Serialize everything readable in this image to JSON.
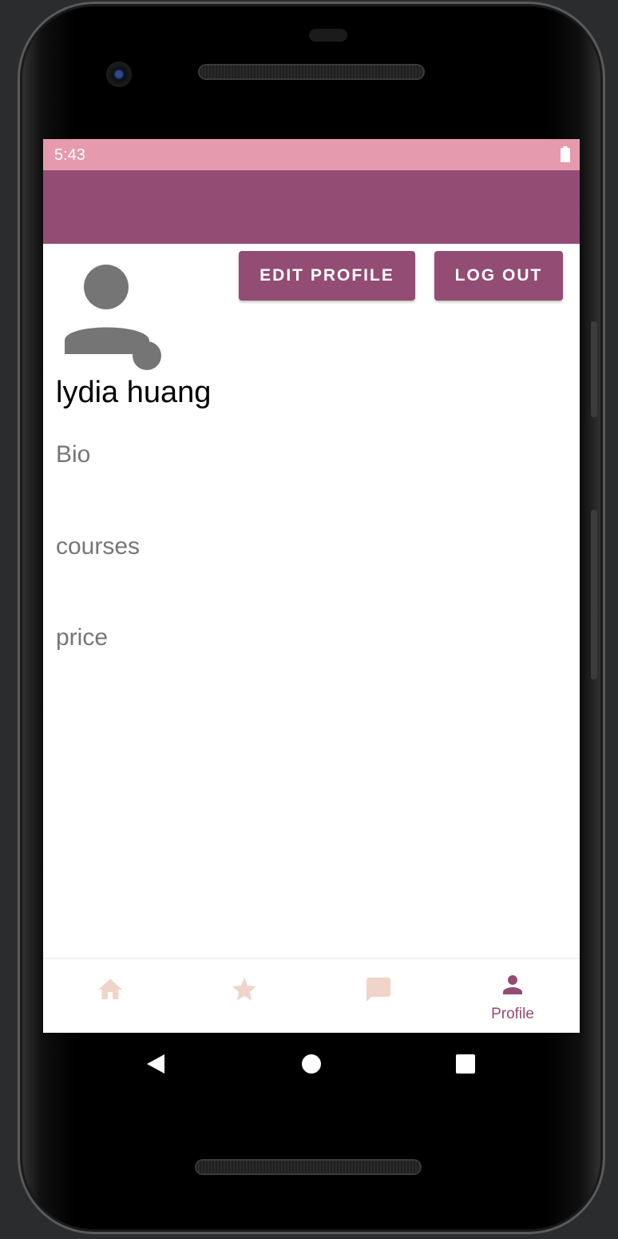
{
  "status_bar": {
    "time": "5:43",
    "icons": [
      "battery-icon"
    ],
    "color": "#e59aae"
  },
  "app_bar": {
    "color": "#934c74"
  },
  "profile": {
    "avatar_icon": "account-circle-icon",
    "name": "lydia huang",
    "fields": {
      "bio": "Bio",
      "courses": "courses",
      "price": "price"
    }
  },
  "actions": {
    "edit_profile_label": "EDIT PROFILE",
    "log_out_label": "LOG OUT",
    "button_color": "#934c74"
  },
  "bottom_nav": {
    "items": [
      {
        "icon": "home-icon",
        "label": "",
        "active": false
      },
      {
        "icon": "star-icon",
        "label": "",
        "active": false
      },
      {
        "icon": "chat-icon",
        "label": "",
        "active": false
      },
      {
        "icon": "person-icon",
        "label": "Profile",
        "active": true
      }
    ],
    "active_color": "#934c74",
    "inactive_color": "#f0d4c8"
  },
  "system_nav": {
    "icons": [
      "back-icon",
      "home-circle-icon",
      "recents-icon"
    ]
  }
}
